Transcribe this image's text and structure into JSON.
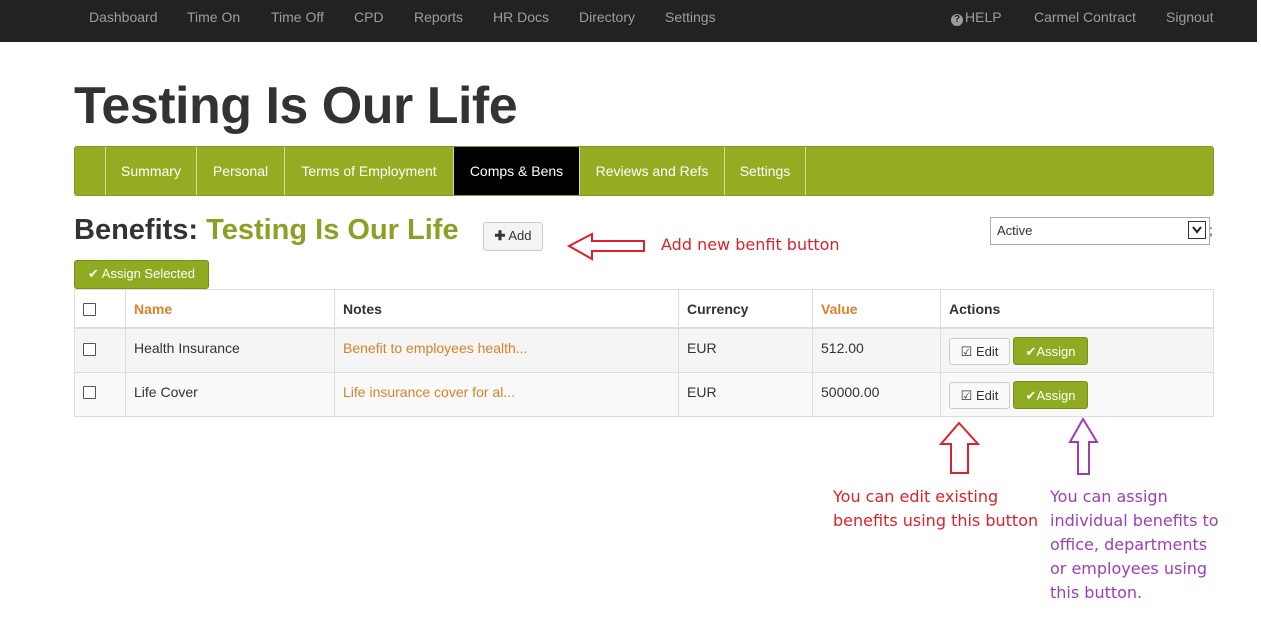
{
  "topnav": {
    "items": [
      "Dashboard",
      "Time On",
      "Time Off",
      "CPD",
      "Reports",
      "HR Docs",
      "Directory",
      "Settings"
    ],
    "help": "HELP",
    "user": "Carmel Contract",
    "signout": "Signout"
  },
  "page": {
    "title": "Testing Is Our Life"
  },
  "subnav": {
    "tabs": [
      "Summary",
      "Personal",
      "Terms of Employment",
      "Comps & Bens",
      "Reviews and Refs",
      "Settings"
    ],
    "active": "Comps & Bens"
  },
  "benefits": {
    "heading": "Benefits:",
    "company": "Testing Is Our Life",
    "add_label": "Add",
    "assign_selected_label": "Assign Selected",
    "status_value": "Active",
    "trailing": ";"
  },
  "table": {
    "columns": [
      "Name",
      "Notes",
      "Currency",
      "Value",
      "Actions"
    ],
    "rows": [
      {
        "name": "Health Insurance",
        "notes": "Benefit to employees health...",
        "currency": "EUR",
        "value": "512.00"
      },
      {
        "name": "Life Cover",
        "notes": "Life insurance cover for al...",
        "currency": "EUR",
        "value": "50000.00"
      }
    ],
    "edit_label": "Edit",
    "assign_label": "Assign"
  },
  "annotations": {
    "add": "Add new benfit button",
    "edit_line1": "You can edit existing",
    "edit_line2": "benefits using this button",
    "assign_line1": "You can assign",
    "assign_line2": "individual benefits to",
    "assign_line3": "office, departments",
    "assign_line4": "or employees using",
    "assign_line5": "this button."
  },
  "colors": {
    "topbar": "#222222",
    "brand_green": "#95ab22",
    "accent_orange": "#d9822b",
    "annotation_red": "#e0202a",
    "annotation_purple": "#9d3fb3"
  }
}
